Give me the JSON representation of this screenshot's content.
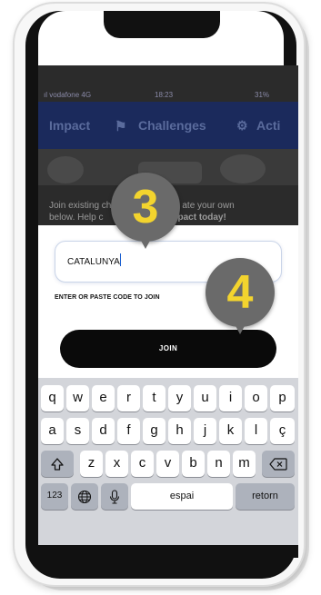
{
  "status_bar": {
    "carrier": "ıl vodafone 4G",
    "time": "18:23",
    "battery": "31%"
  },
  "app_bar": {
    "tab_left": "Impact",
    "tab_center": "Challenges",
    "tab_right": "Acti"
  },
  "background_text": {
    "line1": "Join existing ch",
    "line1b": "ate your own",
    "line2": "below. Help c",
    "line2b": "pact today!"
  },
  "join_modal": {
    "code_value": "CATALUNYA",
    "hint": "ENTER OR PASTE CODE TO JOIN",
    "join_label": "JOIN"
  },
  "keyboard": {
    "row1": [
      "q",
      "w",
      "e",
      "r",
      "t",
      "y",
      "u",
      "i",
      "o",
      "p"
    ],
    "row2": [
      "a",
      "s",
      "d",
      "f",
      "g",
      "h",
      "j",
      "k",
      "l",
      "ç"
    ],
    "row3": [
      "z",
      "x",
      "c",
      "v",
      "b",
      "n",
      "m"
    ],
    "numbers_label": "123",
    "space_label": "espai",
    "return_label": "retorn"
  },
  "step_markers": {
    "first": "3",
    "second": "4"
  },
  "colors": {
    "marker_fill": "#6a6a6a",
    "marker_number": "#f3d42e",
    "app_bar": "#1b2a5c",
    "button": "#0a0a0a"
  },
  "icons": {
    "shift": "shift-icon",
    "delete": "backspace-icon",
    "globe": "globe-icon",
    "mic": "microphone-icon"
  }
}
